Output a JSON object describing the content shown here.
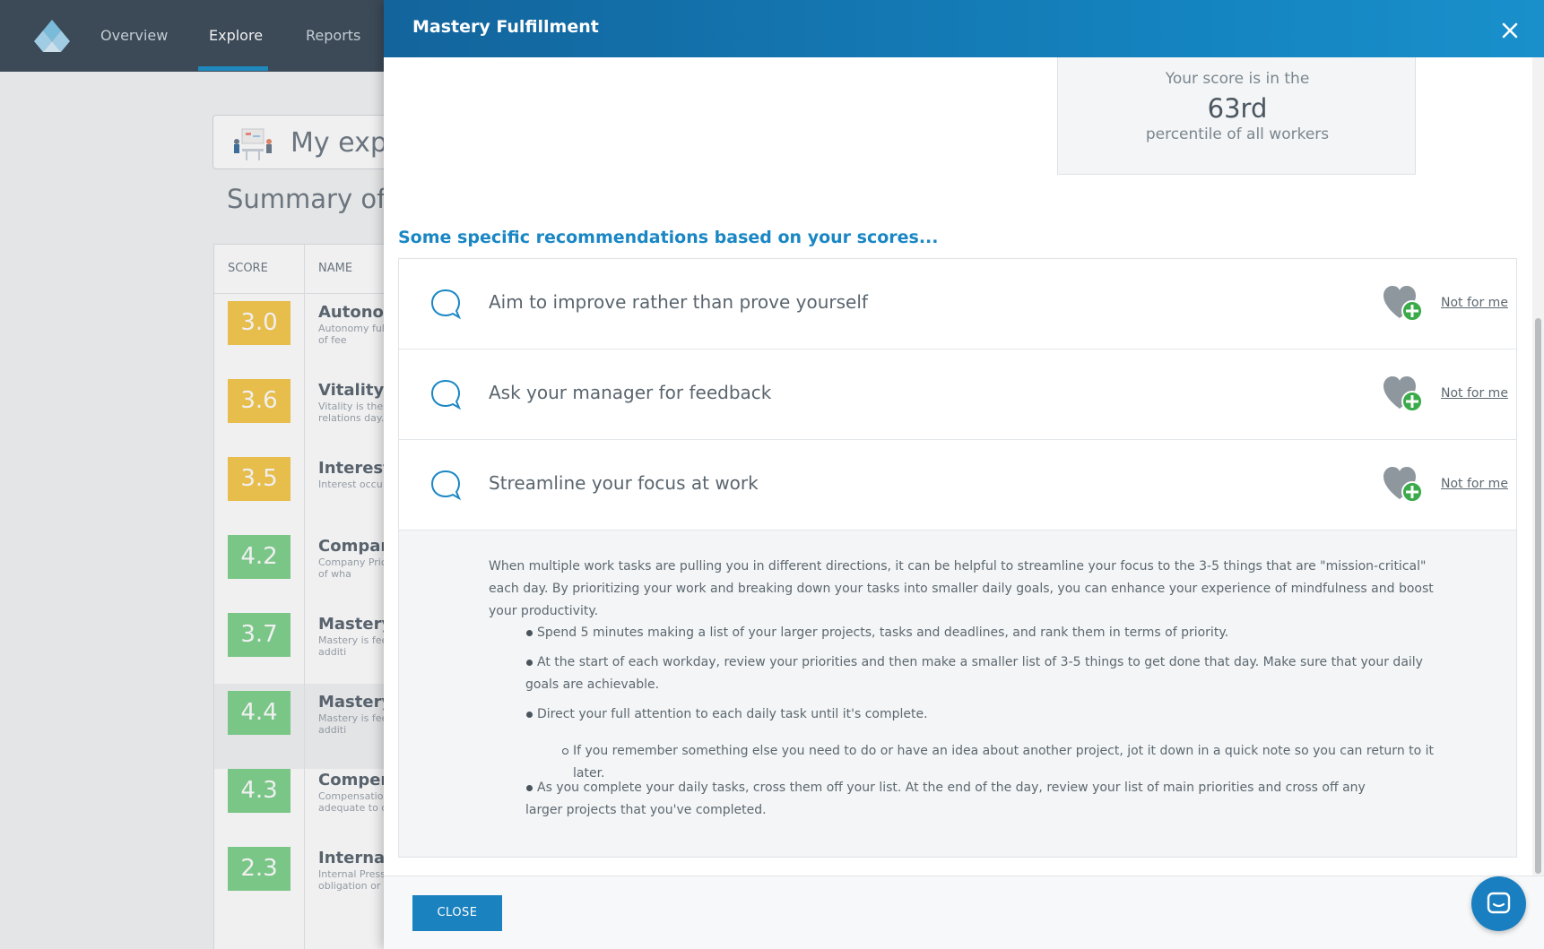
{
  "nav": {
    "items": [
      "Overview",
      "Explore",
      "Reports"
    ],
    "active": "Explore"
  },
  "background": {
    "experience_title": "My expe",
    "summary_title": "Summary of ",
    "table": {
      "headers": [
        "SCORE",
        "NAME"
      ],
      "rows": [
        {
          "score": "3.0",
          "color": "yellow",
          "name": "Autonom",
          "desc": "Autonomy ful instead of fee"
        },
        {
          "score": "3.6",
          "color": "yellow",
          "name": "Vitality",
          "desc": "Vitality is the and relations day.\""
        },
        {
          "score": "3.5",
          "color": "yellow",
          "name": "Interest",
          "desc": "Interest occu"
        },
        {
          "score": "4.2",
          "color": "green",
          "name": "Company",
          "desc": "Company Pric proud of wha"
        },
        {
          "score": "3.7",
          "color": "green",
          "name": "Mastery S",
          "desc": "Mastery is fee seeing additi"
        },
        {
          "score": "4.4",
          "color": "green",
          "name": "Mastery I",
          "desc": "Mastery is fee seeing additi"
        },
        {
          "score": "4.3",
          "color": "green",
          "name": "Compens",
          "desc": "Compensatio adequate to c"
        },
        {
          "score": "2.3",
          "color": "green",
          "name": "Internal I",
          "desc": "Internal Press obligation or"
        }
      ]
    }
  },
  "modal": {
    "title": "Mastery Fulfillment",
    "percentile": {
      "line1": "Your score is in the",
      "value": "63rd",
      "line3": "percentile of all workers"
    },
    "recommendations_heading": "Some specific recommendations based on your scores...",
    "recommendations": [
      {
        "text": "Aim to improve rather than prove yourself",
        "action": "Not for me"
      },
      {
        "text": "Ask your manager for feedback",
        "action": "Not for me"
      },
      {
        "text": "Streamline your focus at work",
        "action": "Not for me"
      }
    ],
    "detail": {
      "paragraph": "When multiple work tasks are pulling you in different directions, it can be helpful to streamline your focus to the 3-5 things that are \"mission-critical\" each day. By prioritizing your work and breaking down your tasks into smaller daily goals, you can enhance your experience of mindfulness and boost your productivity.",
      "bullets": [
        "Spend 5 minutes making a list of your larger projects, tasks and deadlines, and rank them in terms of priority.",
        "At the start of each workday, review your priorities and then make a smaller list of 3-5 things to get done that day. Make sure that your daily goals are achievable.",
        "Direct your full attention to each daily task until it's complete.",
        "If you remember something else you need to do or have an idea about another project, jot it down in a quick note so you can return to it later.",
        "As you complete your daily tasks, cross them off your list. At the end of the day, review your list of main priorities and cross off any larger projects that you've completed."
      ]
    },
    "close_label": "CLOSE"
  },
  "colors": {
    "accent": "#1a82bf",
    "header_dark": "#13649c",
    "score_yellow": "#f6c84b",
    "score_green": "#7ed28b",
    "heart_gray": "#8e979e",
    "plus_green": "#3aaa4a"
  },
  "icons": [
    "close-icon",
    "speech-bubble-icon",
    "heart-plus-icon",
    "chat-icon",
    "logo-icon"
  ]
}
